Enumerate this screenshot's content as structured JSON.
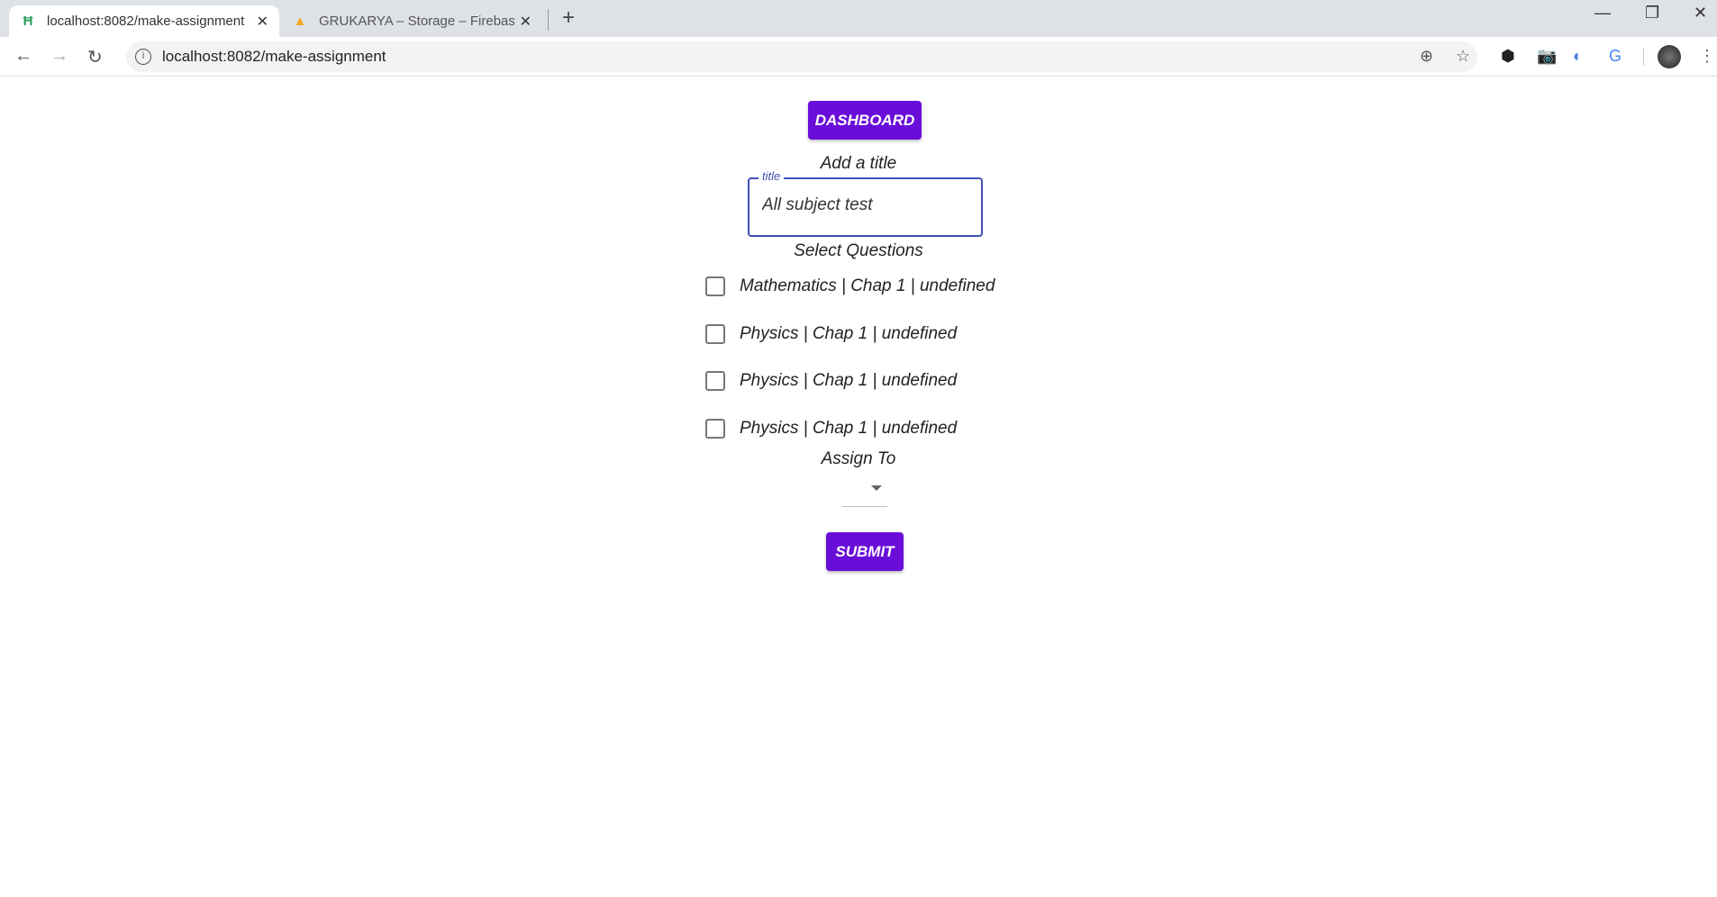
{
  "browser": {
    "tabs": [
      {
        "title": "localhost:8082/make-assignment",
        "favicon": "app-icon",
        "active": true
      },
      {
        "title": "GRUKARYA – Storage – Firebase c",
        "favicon": "firebase-icon",
        "active": false
      }
    ],
    "url": "localhost:8082/make-assignment"
  },
  "page": {
    "dashboard_label": "DASHBOARD",
    "title_heading": "Add a title",
    "title_field": {
      "label": "title",
      "value": "All subject test"
    },
    "questions_heading": "Select Questions",
    "questions": [
      {
        "label": "Mathematics | Chap 1 | undefined",
        "checked": false
      },
      {
        "label": "Physics | Chap 1 | undefined",
        "checked": false
      },
      {
        "label": "Physics | Chap 1 | undefined",
        "checked": false
      },
      {
        "label": "Physics | Chap 1 | undefined",
        "checked": false
      }
    ],
    "assign_heading": "Assign To",
    "assign_value": "",
    "submit_label": "SUBMIT"
  },
  "colors": {
    "accent": "#6a0dd9",
    "field_border": "#3f51b5"
  }
}
